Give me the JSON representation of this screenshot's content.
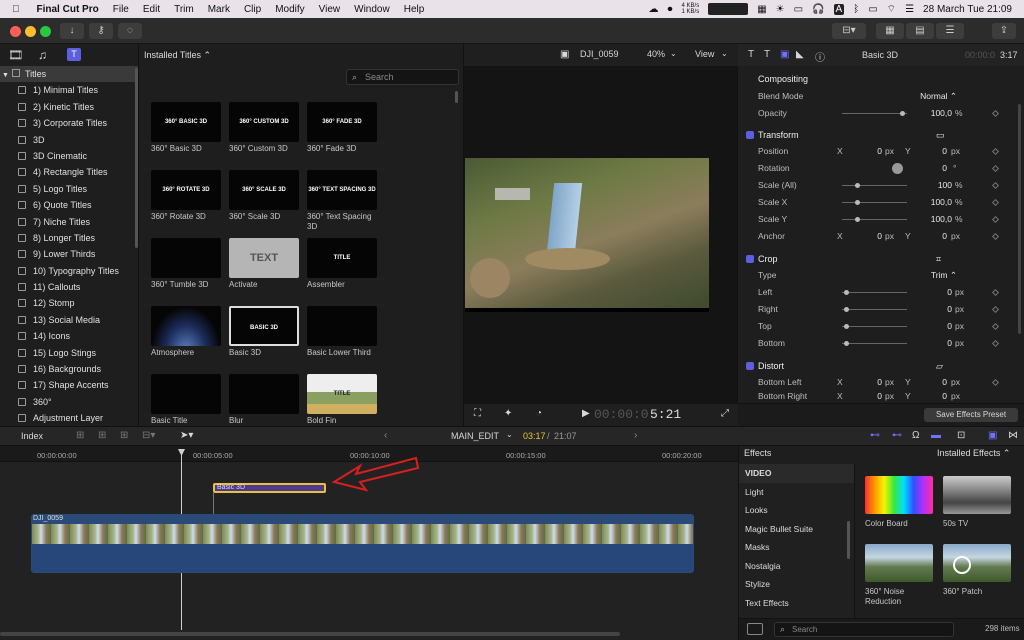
{
  "menubar": {
    "app": "Final Cut Pro",
    "items": [
      "File",
      "Edit",
      "Trim",
      "Mark",
      "Clip",
      "Modify",
      "View",
      "Window",
      "Help"
    ],
    "net_up": "4 KB/s",
    "net_down": "1 KB/s",
    "datetime": "28 March Tue  21:09"
  },
  "browser": {
    "installed_titles": "Installed Titles ⌃",
    "search_placeholder": "Search",
    "tree": [
      "Titles",
      "1) Minimal Titles",
      "2) Kinetic Titles",
      "3) Corporate Titles",
      "3D",
      "3D Cinematic",
      "4) Rectangle Titles",
      "5) Logo Titles",
      "6) Quote Titles",
      "7) Niche Titles",
      "8) Longer Titles",
      "9) Lower Thirds",
      "10) Typography Titles",
      "11) Callouts",
      "12) Stomp",
      "13) Social Media",
      "14) Icons",
      "15) Logo Stings",
      "16) Backgrounds",
      "17) Shape Accents",
      "360°",
      "Adjustment Layer"
    ],
    "thumbs": [
      {
        "art": "360° BASIC 3D",
        "label": "360° Basic 3D"
      },
      {
        "art": "360° CUSTOM 3D",
        "label": "360° Custom 3D"
      },
      {
        "art": "360° FADE 3D",
        "label": "360° Fade 3D"
      },
      {
        "art": "360° ROTATE 3D",
        "label": "360° Rotate 3D"
      },
      {
        "art": "360° SCALE 3D",
        "label": "360° Scale 3D"
      },
      {
        "art": "360° TEXT SPACING 3D",
        "label": "360° Text Spacing 3D"
      },
      {
        "art": "",
        "label": "360° Tumble 3D"
      },
      {
        "art": "TEXT",
        "label": "Activate"
      },
      {
        "art": "TITLE",
        "label": "Assembler"
      },
      {
        "art": "",
        "label": "Atmosphere"
      },
      {
        "art": "BASIC 3D",
        "label": "Basic 3D"
      },
      {
        "art": "",
        "label": "Basic Lower Third"
      },
      {
        "art": "",
        "label": "Basic Title"
      },
      {
        "art": "",
        "label": "Blur"
      },
      {
        "art": "TITLE",
        "label": "Bold Fin"
      }
    ]
  },
  "viewer": {
    "clip_name": "DJI_0059",
    "zoom": "40%",
    "view": "View",
    "timecode_dim": "00:00:0",
    "timecode": "5:21"
  },
  "inspector": {
    "title": "Basic 3D",
    "duration_dim": "00:00:0",
    "duration": "3:17",
    "compositing": "Compositing",
    "blend_mode_label": "Blend Mode",
    "blend_mode": "Normal ⌃",
    "opacity_label": "Opacity",
    "opacity": "100,0",
    "transform": "Transform",
    "position_label": "Position",
    "pos_x": "0",
    "pos_y": "0",
    "rotation_label": "Rotation",
    "rotation": "0",
    "scale_all_label": "Scale (All)",
    "scale_all": "100",
    "scale_x_label": "Scale X",
    "scale_x": "100,0",
    "scale_y_label": "Scale Y",
    "scale_y": "100,0",
    "anchor_label": "Anchor",
    "anchor_x": "0",
    "anchor_y": "0",
    "crop": "Crop",
    "type_label": "Type",
    "type": "Trim ⌃",
    "left_label": "Left",
    "left": "0",
    "right_label": "Right",
    "right": "0",
    "top_label": "Top",
    "top": "0",
    "bottom_label": "Bottom",
    "bottom": "0",
    "distort": "Distort",
    "bl_label": "Bottom Left",
    "bl_x": "0",
    "bl_y": "0",
    "br_label": "Bottom Right",
    "br_x": "0",
    "br_y": "0",
    "save_preset": "Save Effects Preset",
    "x": "X",
    "y": "Y",
    "px": "px",
    "pct": "%",
    "deg": "°"
  },
  "timeline": {
    "index": "Index",
    "project": "MAIN_EDIT",
    "position": "03:17",
    "total": "21:07",
    "ruler": [
      "00:00:00:00",
      "00:00:05:00",
      "00:00:10:00",
      "00:00:15:00",
      "00:00:20:00"
    ],
    "title_clip": "Basic 3D",
    "video_clip": "DJI_0059"
  },
  "effects": {
    "title": "Effects",
    "installed": "Installed Effects ⌃",
    "categories": [
      "VIDEO",
      "Light",
      "Looks",
      "Magic Bullet Suite",
      "Masks",
      "Nostalgia",
      "Stylize",
      "Text Effects"
    ],
    "thumbs": [
      "Color Board",
      "50s TV",
      "360° Noise Reduction",
      "360° Patch"
    ],
    "search_placeholder": "Search",
    "count": "298 items"
  },
  "colors": {
    "accent": "#5b5fe0",
    "title_clip": "#4d3a8f",
    "video_clip": "#2a4a78",
    "annotation": "#d62020",
    "selected_clip_border": "#e8c33a"
  }
}
